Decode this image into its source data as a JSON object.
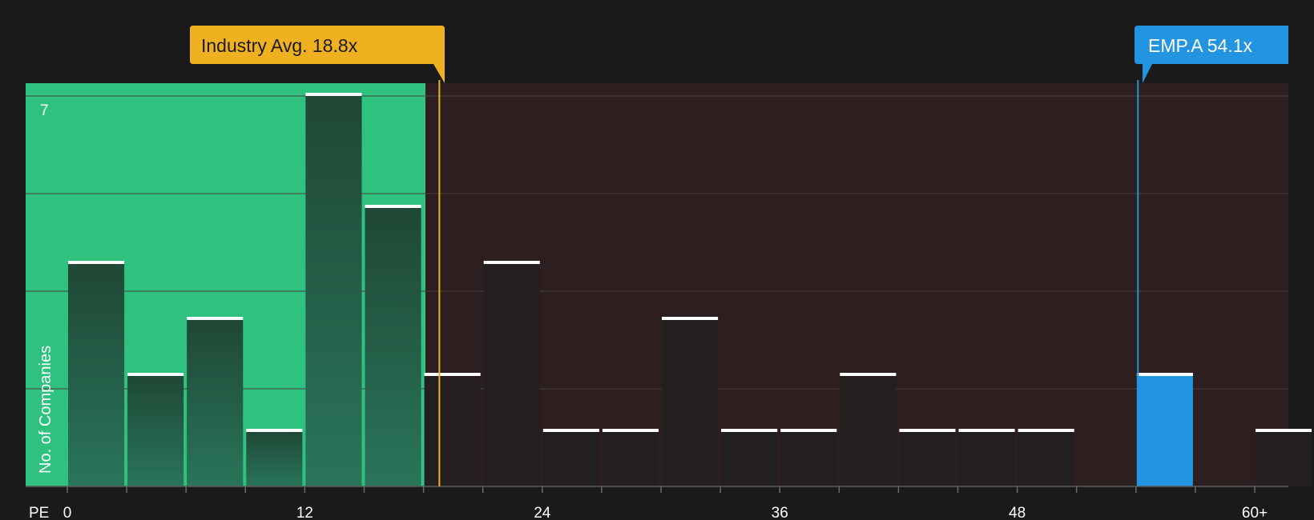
{
  "chart_data": {
    "type": "bar",
    "xlabel": "PE",
    "ylabel": "No. of Companies",
    "x_tick_labels": [
      "0",
      "12",
      "24",
      "36",
      "48",
      "60+"
    ],
    "x_tick_values": [
      0,
      12,
      24,
      36,
      48,
      60
    ],
    "y_tick_labels": [
      "7"
    ],
    "ylim": [
      0,
      7
    ],
    "bin_width": 3,
    "bins": [
      {
        "start": 0,
        "count": 4
      },
      {
        "start": 3,
        "count": 2
      },
      {
        "start": 6,
        "count": 3
      },
      {
        "start": 9,
        "count": 1
      },
      {
        "start": 12,
        "count": 7
      },
      {
        "start": 15,
        "count": 5
      },
      {
        "start": 18,
        "count": 2
      },
      {
        "start": 21,
        "count": 4
      },
      {
        "start": 24,
        "count": 1
      },
      {
        "start": 27,
        "count": 1
      },
      {
        "start": 30,
        "count": 3
      },
      {
        "start": 33,
        "count": 1
      },
      {
        "start": 36,
        "count": 1
      },
      {
        "start": 39,
        "count": 2
      },
      {
        "start": 42,
        "count": 1
      },
      {
        "start": 45,
        "count": 1
      },
      {
        "start": 48,
        "count": 1
      },
      {
        "start": 51,
        "count": 0
      },
      {
        "start": 54,
        "count": 2
      },
      {
        "start": 57,
        "count": 0
      },
      {
        "start": 60,
        "count": 1
      }
    ],
    "industry_avg": {
      "label": "Industry Avg. 18.8x",
      "value": 18.8
    },
    "company": {
      "label": "EMP.A 54.1x",
      "value": 54.1
    },
    "colors": {
      "background": "#1a1a1a",
      "undervalued_region": "#2ec27e",
      "overvalued_region": "#2d1e1f",
      "bar_dark": "#231f1f",
      "bar_green_top": "#1f4735",
      "bar_green_bottom": "#29755a",
      "company_bar": "#2394e0",
      "industry_line": "#f0b120",
      "bar_cap": "#ffffff",
      "gridline": "#4a4040"
    }
  }
}
